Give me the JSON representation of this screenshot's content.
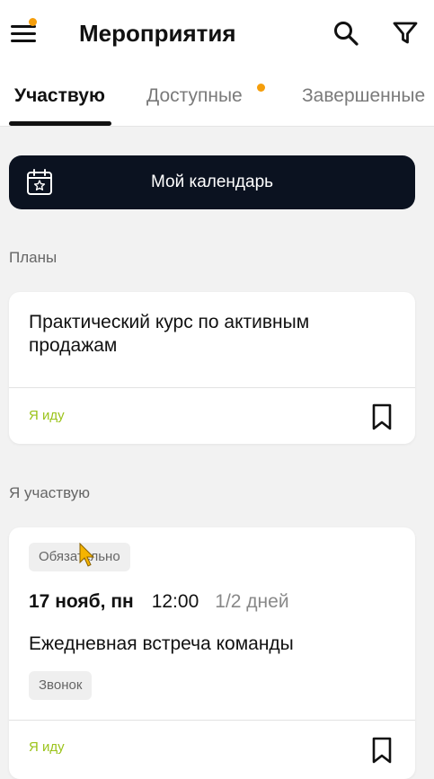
{
  "header": {
    "title": "Мероприятия",
    "menu_icon": "hamburger-menu-icon",
    "notification_dot_color": "#f59e0b",
    "search_icon": "search-icon",
    "filter_icon": "filter-icon"
  },
  "tabs": [
    {
      "label": "Участвую",
      "active": true
    },
    {
      "label": "Доступные",
      "active": false,
      "has_dot": true
    },
    {
      "label": "Завершенные",
      "active": false
    }
  ],
  "calendar_button": {
    "label": "Мой календарь",
    "icon": "calendar-star-icon"
  },
  "sections": {
    "plans": {
      "label": "Планы",
      "card": {
        "title": "Практический курс по активным продажам",
        "status": "Я иду",
        "bookmark_icon": "bookmark-icon"
      }
    },
    "participating": {
      "label": "Я участвую",
      "card": {
        "chip_required": "Обязательно",
        "date": "17 нояб, пн",
        "time": "12:00",
        "duration": "1/2 дней",
        "title": "Ежедневная встреча команды",
        "chip_type": "Звонок",
        "status": "Я иду",
        "bookmark_icon": "bookmark-icon"
      }
    }
  },
  "colors": {
    "accent_dark": "#0b1220",
    "status_green": "#9bc31b",
    "background": "#f2f2f2"
  }
}
